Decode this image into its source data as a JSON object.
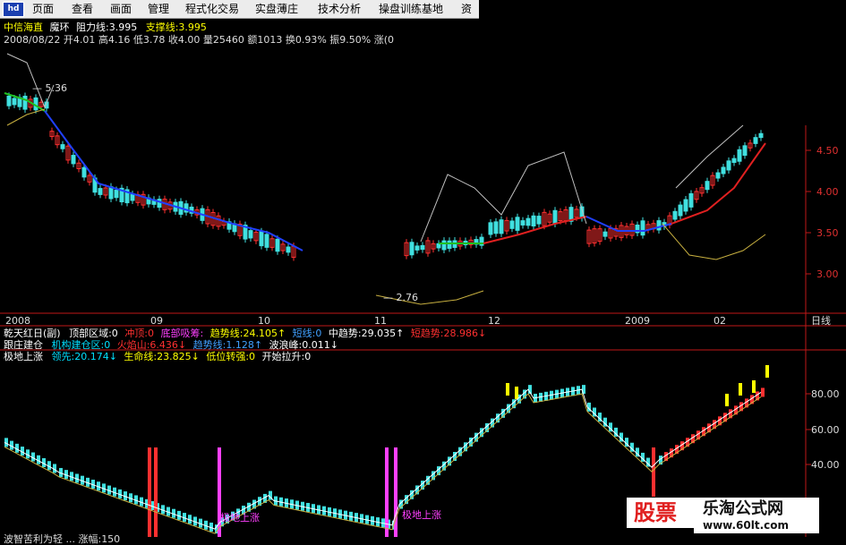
{
  "menu": {
    "items": [
      "页面",
      "查看",
      "画面",
      "管理",
      "程式化交易",
      "实盘薄庄",
      "技术分析",
      "操盘训练基地",
      "资"
    ]
  },
  "app_logo": "hd",
  "header": {
    "stock_name": "中信海直",
    "indicator": "魔环",
    "resist_label": "阻力线:3.995",
    "support_label": "支撑线:3.995",
    "info_line": "2008/08/22 开4.01 高4.16 低3.78 收4.00 量25460 额1013 换0.93% 振9.50% 涨(0"
  },
  "main_chart": {
    "price_ticks": [
      "4.50",
      "4.00",
      "3.50",
      "3.00"
    ],
    "high_annotation": "5.36",
    "low_annotation": "2.76",
    "date_ticks": [
      "2008",
      "09",
      "10",
      "11",
      "12",
      "2009",
      "02"
    ],
    "period_label": "日线"
  },
  "indicators": {
    "row1": [
      {
        "text": "乾天红日(副)",
        "color": "#ffffff"
      },
      {
        "text": "顶部区域:0",
        "color": "#ffffff"
      },
      {
        "text": "冲顶:0",
        "color": "#ff3030"
      },
      {
        "text": "底部吸筹:",
        "color": "#ff40ff"
      },
      {
        "text": "趋势线:24.105↑",
        "color": "#ffff00"
      },
      {
        "text": "短线:0",
        "color": "#40a0ff"
      },
      {
        "text": "中趋势:29.035↑",
        "color": "#ffffff"
      },
      {
        "text": "短趋势:28.986↓",
        "color": "#ff3030"
      }
    ],
    "row2": [
      {
        "text": "跟庄建仓",
        "color": "#ffffff"
      },
      {
        "text": "机构建仓区:0",
        "color": "#00e0ff"
      },
      {
        "text": "火焰山:6.436↓",
        "color": "#ff3030"
      },
      {
        "text": "趋势线:1.128↑",
        "color": "#40a0ff"
      },
      {
        "text": "波浪峰:0.011↓",
        "color": "#ffffff"
      }
    ],
    "row3": [
      {
        "text": "极地上涨",
        "color": "#ffffff"
      },
      {
        "text": "领先:20.174↓",
        "color": "#00e0ff"
      },
      {
        "text": "生命线:23.825↓",
        "color": "#ffff00"
      },
      {
        "text": "低位转强:0",
        "color": "#ffff00"
      },
      {
        "text": "开始拉升:0",
        "color": "#ffffff"
      }
    ]
  },
  "sub_chart": {
    "ticks": [
      "80.00",
      "60.00",
      "40.00"
    ],
    "signal_label_1": "极地上涨",
    "signal_label_2": "极地上涨",
    "bottom_text": "波智苦利为轻 ... 涨幅:150"
  },
  "watermark": {
    "brand": "股票",
    "site_name": "乐淘公式网",
    "url": "www.60lt.com"
  },
  "colors": {
    "up": "#ff3030",
    "down": "#40e0e0",
    "ma_green": "#20c020",
    "ma_blue": "#2040ff",
    "ma_red": "#e02020",
    "band": "#c0c0c0",
    "band_low": "#c8b040",
    "axis": "#c01818"
  }
}
